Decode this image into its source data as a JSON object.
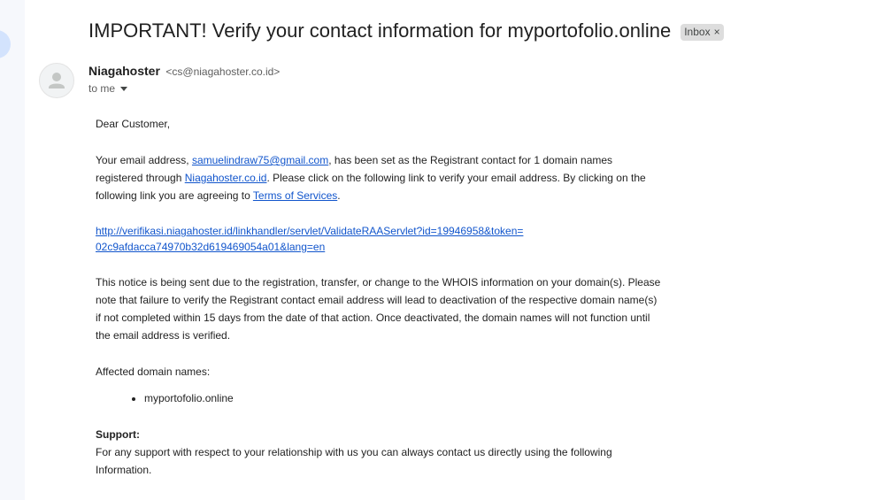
{
  "email": {
    "subject": "IMPORTANT! Verify your contact information for myportofolio.online",
    "label": "Inbox",
    "label_close": "×",
    "sender_name": "Niagahoster",
    "sender_email": "<cs@niagahoster.co.id>",
    "to_text": "to me"
  },
  "body": {
    "greeting": "Dear Customer,",
    "p1_a": "Your email address, ",
    "p1_email_link": "samuelindraw75@gmail.com",
    "p1_b": ", has been set as the Registrant contact for 1 domain names registered through ",
    "p1_site_link": "Niagahoster.co.id",
    "p1_c": ". Please click on the following link to verify your email address. By clicking on the following link you are agreeing to ",
    "p1_terms_link": "Terms of Services",
    "p1_d": ".",
    "verify_link_line1": "http://verifikasi.niagahoster.id/linkhandler/servlet/ValidateRAAServlet?id=19946958&token=",
    "verify_link_line2": "02c9afdacca74970b32d619469054a01&lang=en",
    "p2": "This notice is being sent due to the registration, transfer, or change to the WHOIS information on your domain(s). Please note that failure to verify the Registrant contact email address will lead to deactivation of the respective domain name(s) if not completed within 15 days from the date of that action. Once deactivated, the domain names will not function until the email address is verified.",
    "affected_title": "Affected domain names:",
    "affected_domains": [
      "myportofolio.online"
    ],
    "support_title": "Support:",
    "support_text": "For any support with respect to your relationship with us you can always contact us directly using the following Information."
  },
  "icons": {
    "avatar": "person-icon",
    "dropdown": "chevron-down-icon"
  },
  "colors": {
    "link": "#1155cc",
    "rail": "#f6f8fc",
    "chip": "#dddddd"
  }
}
